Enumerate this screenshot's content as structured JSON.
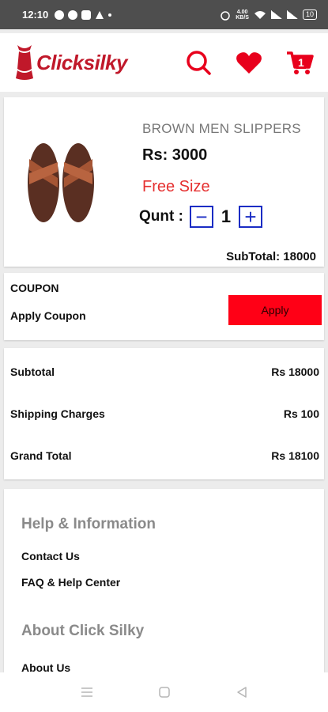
{
  "status_bar": {
    "time": "12:10",
    "network_speed": "4.00\nKB/S",
    "battery": "10"
  },
  "header": {
    "logo_text": "Clicksilky",
    "cart_count": "1"
  },
  "product": {
    "name": "BROWN MEN SLIPPERS",
    "price": "Rs: 3000",
    "size": "Free Size",
    "qty_label": "Qunt :",
    "qty_minus": "−",
    "qty_value": "1",
    "qty_plus": "+",
    "subtotal": "SubTotal: 18000"
  },
  "coupon": {
    "title": "COUPON",
    "subtitle": "Apply Coupon",
    "apply_label": "Apply"
  },
  "totals": {
    "rows": [
      {
        "label": "Subtotal",
        "value": "Rs 18000"
      },
      {
        "label": "Shipping Charges",
        "value": "Rs 100"
      },
      {
        "label": "Grand Total",
        "value": "Rs 18100"
      }
    ]
  },
  "footer": {
    "help_heading": "Help & Information",
    "help_links": [
      "Contact Us",
      "FAQ & Help Center"
    ],
    "about_heading": "About Click Silky",
    "about_links": [
      "About Us"
    ]
  },
  "colors": {
    "brand_red": "#e8001c",
    "price_red": "#e53030",
    "qty_blue": "#1a2cc4",
    "apply_red": "#ff0016"
  },
  "icons": [
    "whatsapp-icon",
    "facebook-icon",
    "instagram-icon",
    "alert-icon",
    "alarm-icon",
    "wifi-icon",
    "signal-icon",
    "battery-icon",
    "search-icon",
    "heart-icon",
    "cart-icon",
    "menu-icon",
    "home-icon",
    "back-icon"
  ]
}
